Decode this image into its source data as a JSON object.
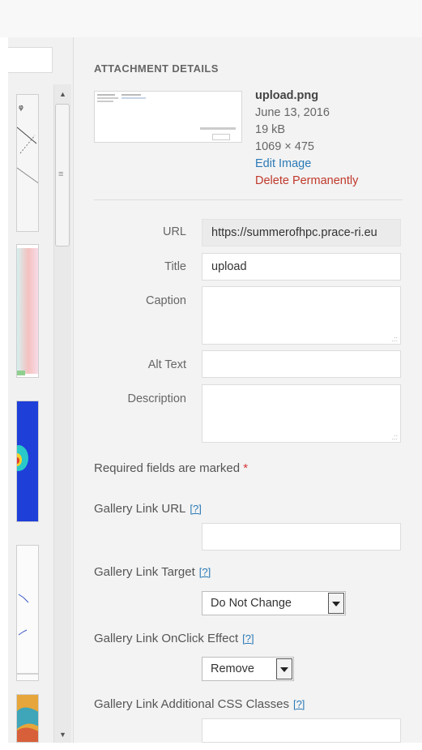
{
  "header": {
    "section_title": "ATTACHMENT DETAILS"
  },
  "attachment": {
    "filename": "upload.png",
    "date": "June 13, 2016",
    "size": "19 kB",
    "dimensions": "1069 × 475",
    "edit_label": "Edit Image",
    "delete_label": "Delete Permanently"
  },
  "fields": {
    "url": {
      "label": "URL",
      "value": "https://summerofhpc.prace-ri.eu"
    },
    "title": {
      "label": "Title",
      "value": "upload"
    },
    "caption": {
      "label": "Caption",
      "value": ""
    },
    "alt_text": {
      "label": "Alt Text",
      "value": ""
    },
    "description": {
      "label": "Description",
      "value": ""
    }
  },
  "required_note": {
    "text": "Required fields are marked",
    "star": "*"
  },
  "gallery": {
    "help": "[?]",
    "link_url_label": "Gallery Link URL",
    "link_url_value": "",
    "link_target_label": "Gallery Link Target",
    "link_target_value": "Do Not Change",
    "onclick_label": "Gallery Link OnClick Effect",
    "onclick_value": "Remove",
    "css_classes_label": "Gallery Link Additional CSS Classes",
    "css_classes_value": ""
  },
  "colors": {
    "link": "#2a7ab6",
    "danger": "#c0392b",
    "required": "#d63638"
  },
  "icons": {
    "scroll_up": "triangle-up-icon",
    "scroll_down": "triangle-down-icon",
    "dropdown": "chevron-down-icon"
  }
}
